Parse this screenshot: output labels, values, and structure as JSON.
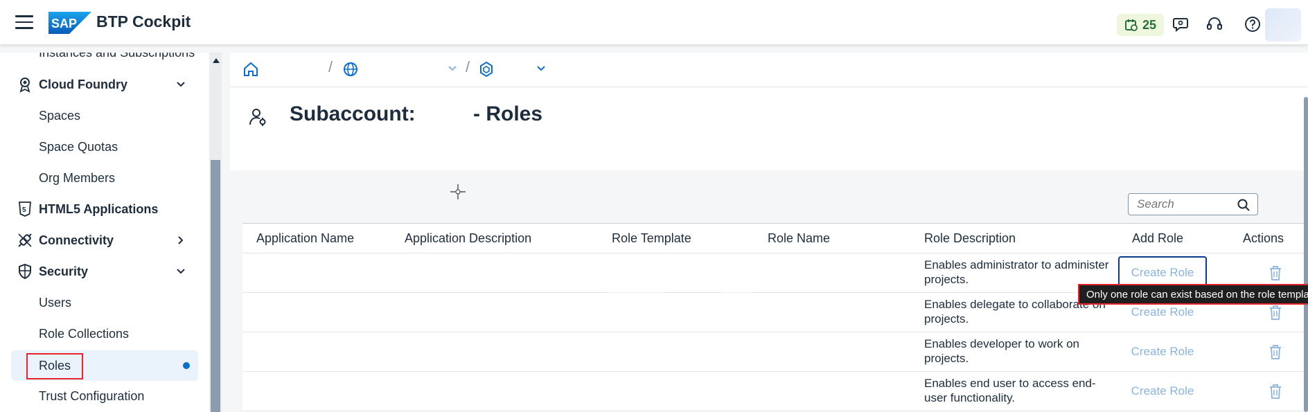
{
  "shell": {
    "title": "BTP Cockpit",
    "logo_text": "SAP",
    "notification_count": "25",
    "icons": [
      "menu-icon",
      "notification-calendar-icon",
      "feedback-icon",
      "support-headset-icon",
      "help-icon"
    ]
  },
  "sidebar": {
    "items": [
      {
        "label": "Instances and Subscriptions",
        "type": "sub"
      },
      {
        "label": "Cloud Foundry",
        "type": "group",
        "expanded": true,
        "icon": "cloud-foundry-icon"
      },
      {
        "label": "Spaces",
        "type": "sub"
      },
      {
        "label": "Space Quotas",
        "type": "sub"
      },
      {
        "label": "Org Members",
        "type": "sub"
      },
      {
        "label": "HTML5 Applications",
        "type": "group",
        "icon": "html5-icon"
      },
      {
        "label": "Connectivity",
        "type": "group",
        "expanded": false,
        "icon": "connectivity-icon"
      },
      {
        "label": "Security",
        "type": "group",
        "expanded": true,
        "icon": "shield-icon"
      },
      {
        "label": "Users",
        "type": "sub"
      },
      {
        "label": "Role Collections",
        "type": "sub"
      },
      {
        "label": "Roles",
        "type": "sub",
        "selected": true
      },
      {
        "label": "Trust Configuration",
        "type": "sub"
      }
    ]
  },
  "breadcrumb": {
    "separator": "/",
    "icons": [
      "home-icon",
      "globe-icon",
      "subaccount-icon"
    ]
  },
  "page": {
    "title": "Subaccount:          - Roles"
  },
  "search": {
    "placeholder": "Search"
  },
  "table": {
    "columns": [
      "Application Name",
      "Application Description",
      "Role Template",
      "Role Name",
      "Role Description",
      "Add Role",
      "Actions"
    ],
    "rows": [
      {
        "description": "Enables administrator to administer projects.",
        "action": "Create Role"
      },
      {
        "description": "Enables delegate to collaborate on projects.",
        "action": "Create Role"
      },
      {
        "description": "Enables developer to work on projects.",
        "action": "Create Role"
      },
      {
        "description": "Enables end user to access end-user functionality.",
        "action": "Create Role"
      }
    ]
  },
  "tooltip": {
    "text": "Only one role can exist based on the role template"
  },
  "colors": {
    "accent": "#0a6ed1",
    "highlight_red": "#e5252a",
    "notification_bg": "#eef6dd",
    "notification_text": "#256f3a"
  }
}
